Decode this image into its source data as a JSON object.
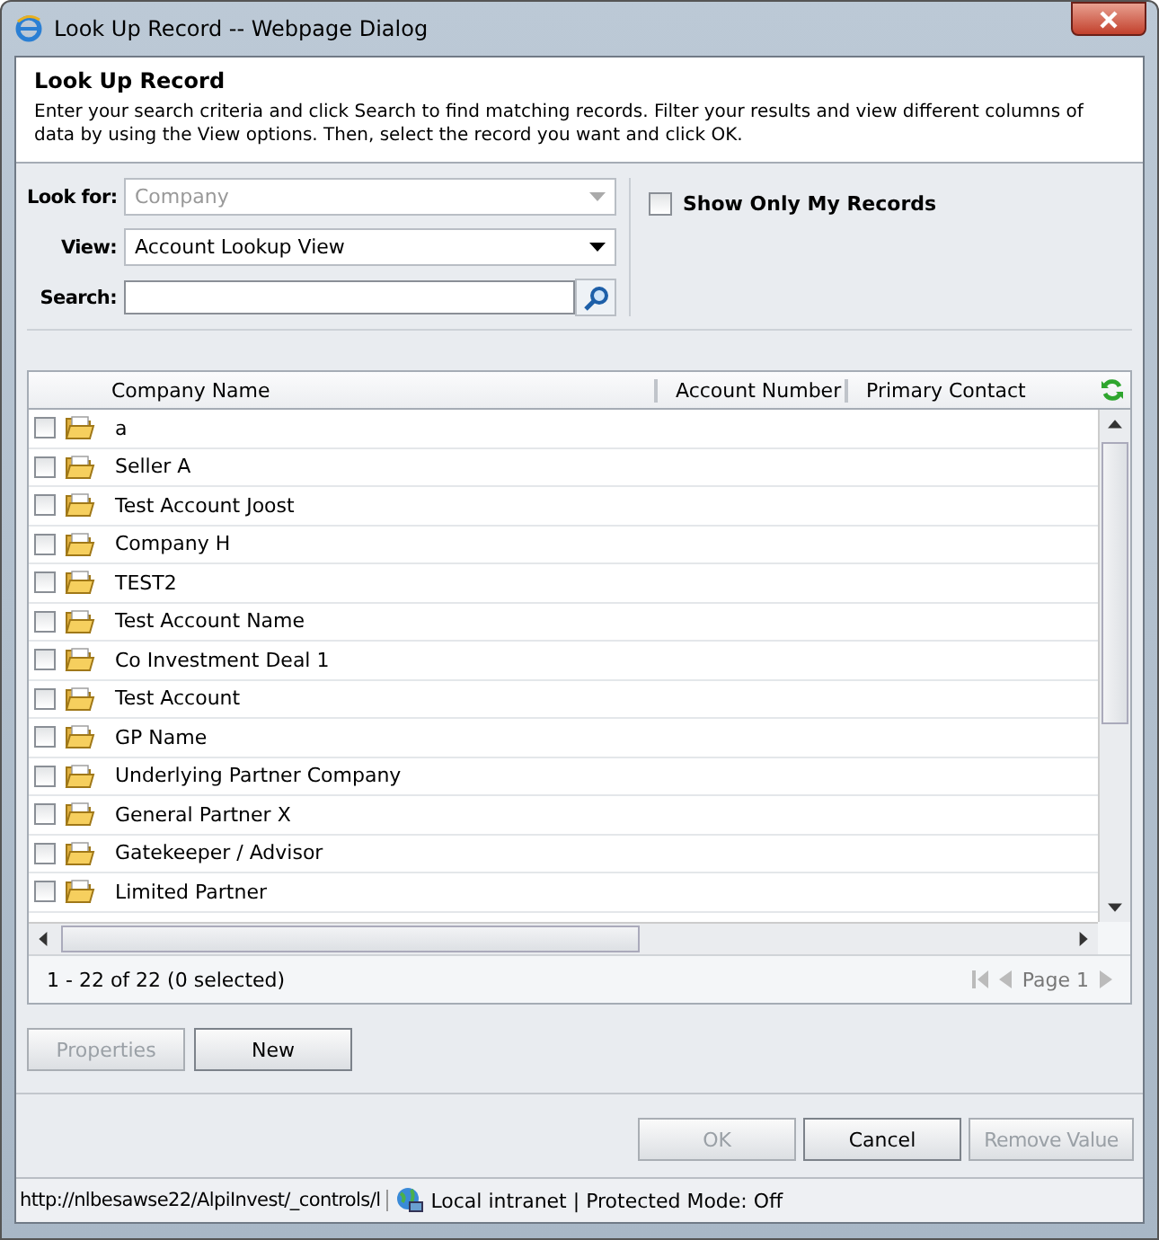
{
  "window": {
    "title": "Look Up Record -- Webpage Dialog"
  },
  "header": {
    "title": "Look Up Record",
    "description": "Enter your search criteria and click Search to find matching records. Filter your results and view different columns of data by using the View options. Then, select the record you want and click OK."
  },
  "form": {
    "look_for": {
      "label": "Look for:",
      "value": "Company",
      "disabled": true
    },
    "view": {
      "label": "View:",
      "value": "Account Lookup View",
      "disabled": false
    },
    "search": {
      "label": "Search:"
    },
    "show_only_mine": {
      "label": "Show Only My Records",
      "checked": false
    }
  },
  "table": {
    "columns": [
      "Company Name",
      "Account Number",
      "Primary Contact"
    ],
    "rows": [
      {
        "name": "a",
        "checked": false
      },
      {
        "name": "Seller A",
        "checked": false
      },
      {
        "name": "Test Account Joost",
        "checked": false
      },
      {
        "name": "Company H",
        "checked": false
      },
      {
        "name": "TEST2",
        "checked": false
      },
      {
        "name": "Test Account Name",
        "checked": false
      },
      {
        "name": "Co Investment Deal 1",
        "checked": false
      },
      {
        "name": "Test Account",
        "checked": false
      },
      {
        "name": "GP Name",
        "checked": false
      },
      {
        "name": "Underlying Partner Company",
        "checked": false
      },
      {
        "name": "General Partner X",
        "checked": false
      },
      {
        "name": "Gatekeeper / Advisor",
        "checked": false
      },
      {
        "name": "Limited Partner",
        "checked": false
      }
    ],
    "summary": "1 - 22 of 22 (0 selected)",
    "page": "Page 1"
  },
  "actions": [
    {
      "label": "Properties",
      "disabled": true
    },
    {
      "label": "New",
      "disabled": false
    }
  ],
  "footer_buttons": [
    {
      "label": "OK",
      "disabled": true
    },
    {
      "label": "Cancel",
      "disabled": false
    },
    {
      "label": "Remove Value",
      "disabled": true
    }
  ],
  "status_bar": {
    "url": "http://nlbesawse22/AlpiInvest/_controls/l",
    "zone": "Local intranet | Protected Mode: Off"
  }
}
